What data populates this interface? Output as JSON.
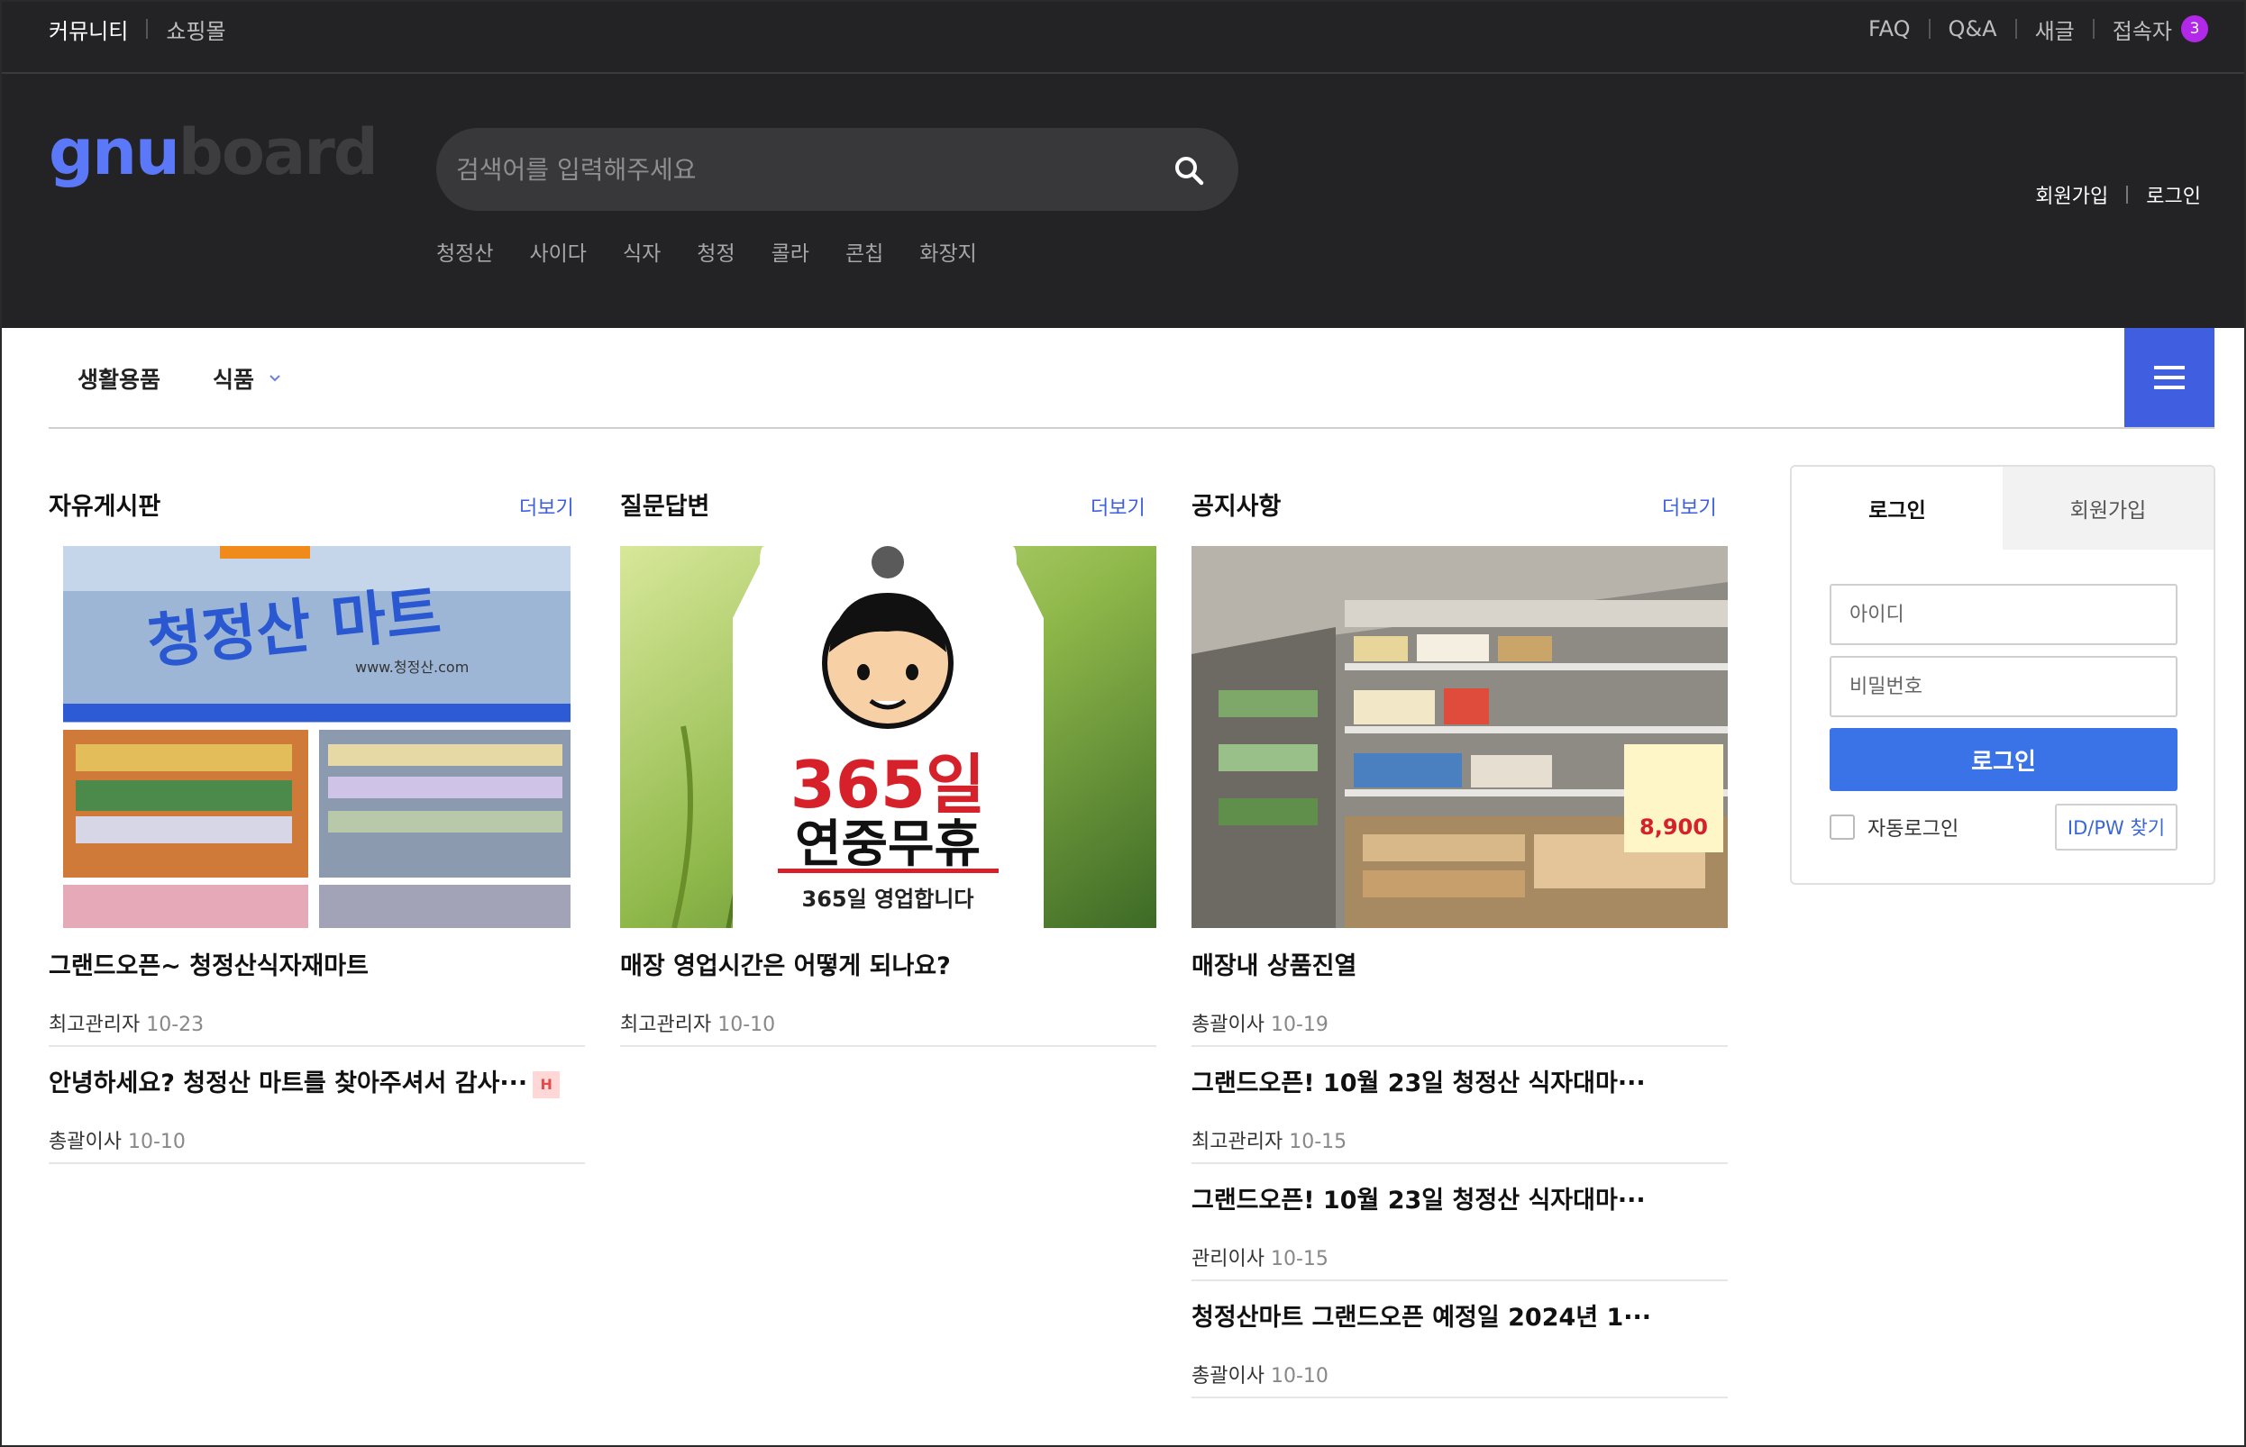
{
  "topbar": {
    "community": "커뮤니티",
    "shop": "쇼핑몰",
    "faq": "FAQ",
    "qa": "Q&A",
    "new": "새글",
    "visitors": "접속자",
    "visitor_count": "3"
  },
  "header": {
    "logo_part1": "gnu",
    "logo_part2": "board",
    "search_placeholder": "검색어를 입력해주세요",
    "keywords": [
      "청정산",
      "사이다",
      "식자",
      "청정",
      "콜라",
      "콘칩",
      "화장지"
    ],
    "signup": "회원가입",
    "login": "로그인"
  },
  "nav": {
    "items": [
      "생활용품",
      "식품"
    ]
  },
  "boards": [
    {
      "title": "자유게시판",
      "more": "더보기",
      "thumb_text": [
        "청정산 마트",
        "www.청정산.com"
      ],
      "posts": [
        {
          "title": "그랜드오픈~ 청정산식자재마트",
          "author": "최고관리자",
          "date": "10-23"
        },
        {
          "title": "안녕하세요? 청정산 마트를 찾아주셔서 감사···",
          "author": "총괄이사",
          "date": "10-10",
          "badge": "H"
        }
      ]
    },
    {
      "title": "질문답변",
      "more": "더보기",
      "thumb_text": [
        "365일",
        "연중무휴",
        "365일 영업합니다"
      ],
      "posts": [
        {
          "title": "매장 영업시간은 어떻게 되나요?",
          "author": "최고관리자",
          "date": "10-10"
        }
      ]
    },
    {
      "title": "공지사항",
      "more": "더보기",
      "thumb_text": [
        "8,900"
      ],
      "posts": [
        {
          "title": "매장내 상품진열",
          "author": "총괄이사",
          "date": "10-19"
        },
        {
          "title": "그랜드오픈! 10월 23일 청정산 식자대마···",
          "author": "최고관리자",
          "date": "10-15"
        },
        {
          "title": "그랜드오픈! 10월 23일 청정산 식자대마···",
          "author": "관리이사",
          "date": "10-15"
        },
        {
          "title": "청정산마트 그랜드오픈 예정일 2024년 1···",
          "author": "총괄이사",
          "date": "10-10"
        }
      ]
    }
  ],
  "login": {
    "tab_login": "로그인",
    "tab_signup": "회원가입",
    "id_placeholder": "아이디",
    "pw_placeholder": "비밀번호",
    "submit": "로그인",
    "auto_login": "자동로그인",
    "find": "ID/PW 찾기"
  },
  "colors": {
    "dark_bg": "#232224",
    "accent_blue": "#3f5ee0",
    "login_btn": "#3a73e8",
    "badge_purple": "#b128e8"
  }
}
